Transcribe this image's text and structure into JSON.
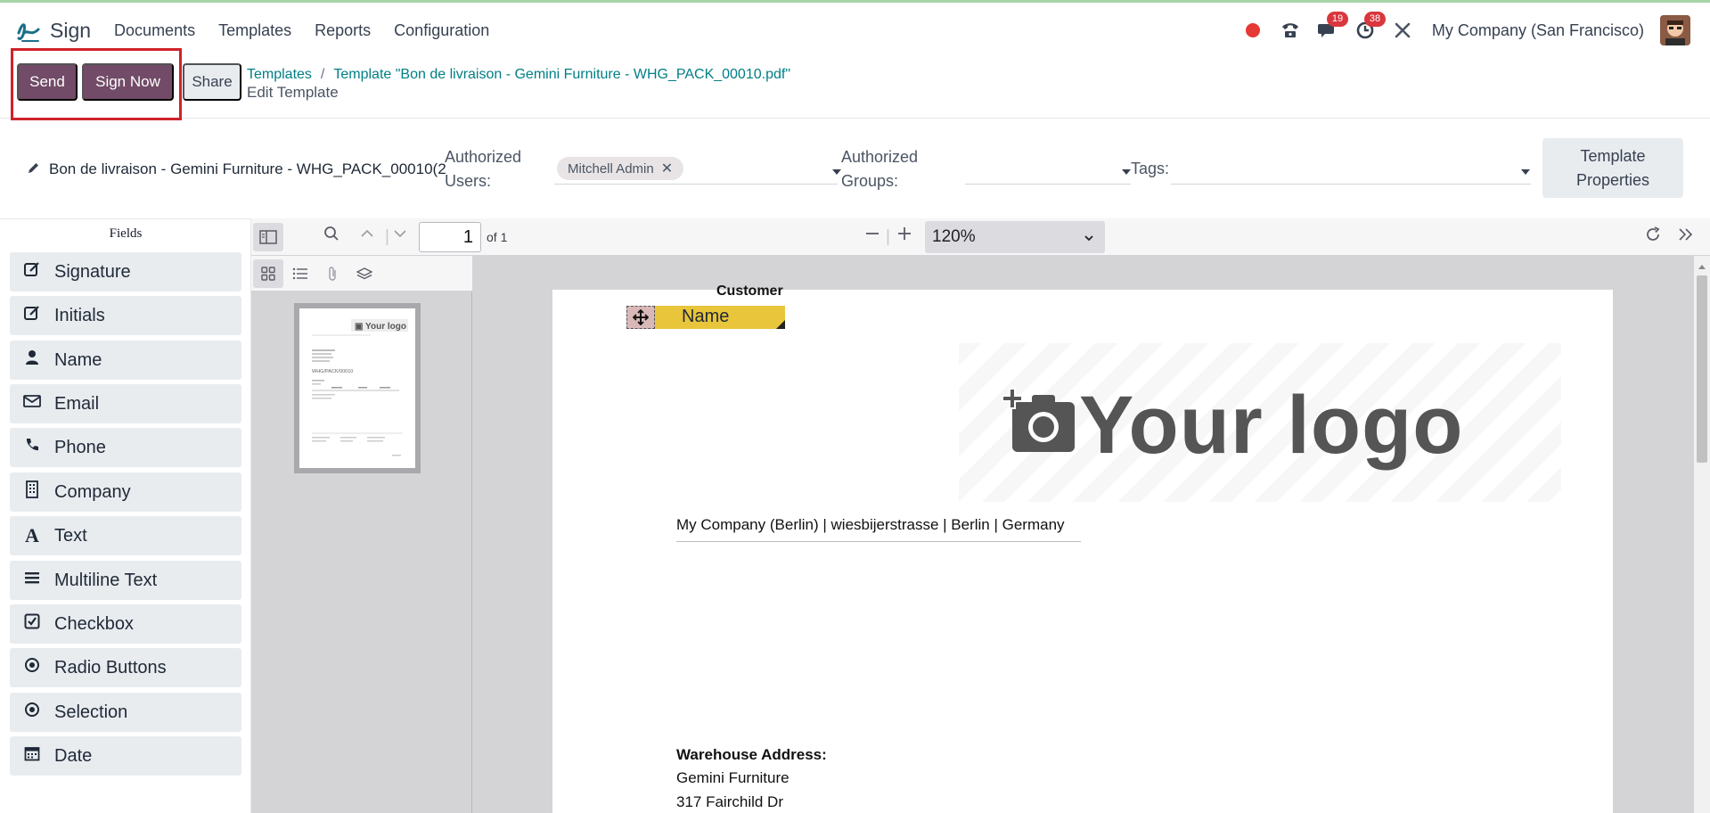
{
  "navbar": {
    "app_name": "Sign",
    "menu": [
      "Documents",
      "Templates",
      "Reports",
      "Configuration"
    ],
    "messages_count": "19",
    "activities_count": "38",
    "company": "My Company (San Francisco)"
  },
  "control": {
    "send_label": "Send",
    "sign_now_label": "Sign Now",
    "share_label": "Share",
    "breadcrumb_root": "Templates",
    "breadcrumb_sep": "/",
    "breadcrumb_current": "Template \"Bon de livraison - Gemini Furniture - WHG_PACK_00010.pdf\"",
    "subtitle": "Edit Template"
  },
  "template": {
    "name": "Bon de livraison - Gemini Furniture - WHG_PACK_00010(2",
    "authorized_users_label_1": "Authorized",
    "authorized_users_label_2": "Users:",
    "authorized_user_tag": "Mitchell Admin",
    "authorized_groups_label_1": "Authorized",
    "authorized_groups_label_2": "Groups:",
    "tags_label": "Tags:",
    "properties_label_1": "Template",
    "properties_label_2": "Properties"
  },
  "fields": {
    "title": "Fields",
    "items": [
      {
        "label": "Signature",
        "icon": "signature-icon"
      },
      {
        "label": "Initials",
        "icon": "initials-icon"
      },
      {
        "label": "Name",
        "icon": "user-icon"
      },
      {
        "label": "Email",
        "icon": "envelope-icon"
      },
      {
        "label": "Phone",
        "icon": "phone-icon"
      },
      {
        "label": "Company",
        "icon": "building-icon"
      },
      {
        "label": "Text",
        "icon": "text-icon"
      },
      {
        "label": "Multiline Text",
        "icon": "lines-icon"
      },
      {
        "label": "Checkbox",
        "icon": "checkbox-icon"
      },
      {
        "label": "Radio Buttons",
        "icon": "radio-icon"
      },
      {
        "label": "Selection",
        "icon": "selection-icon"
      },
      {
        "label": "Date",
        "icon": "calendar-icon"
      }
    ]
  },
  "pdf": {
    "page_number": "1",
    "page_of": "of 1",
    "zoom": "120%"
  },
  "document": {
    "customer_label": "Customer",
    "name_field_label": "Name",
    "logo_text": "Your logo",
    "company_address": "My Company (Berlin) | wiesbijerstrasse | Berlin | Germany",
    "warehouse_label": "Warehouse Address:",
    "warehouse_lines": [
      "Gemini Furniture",
      "317 Fairchild Dr"
    ]
  }
}
